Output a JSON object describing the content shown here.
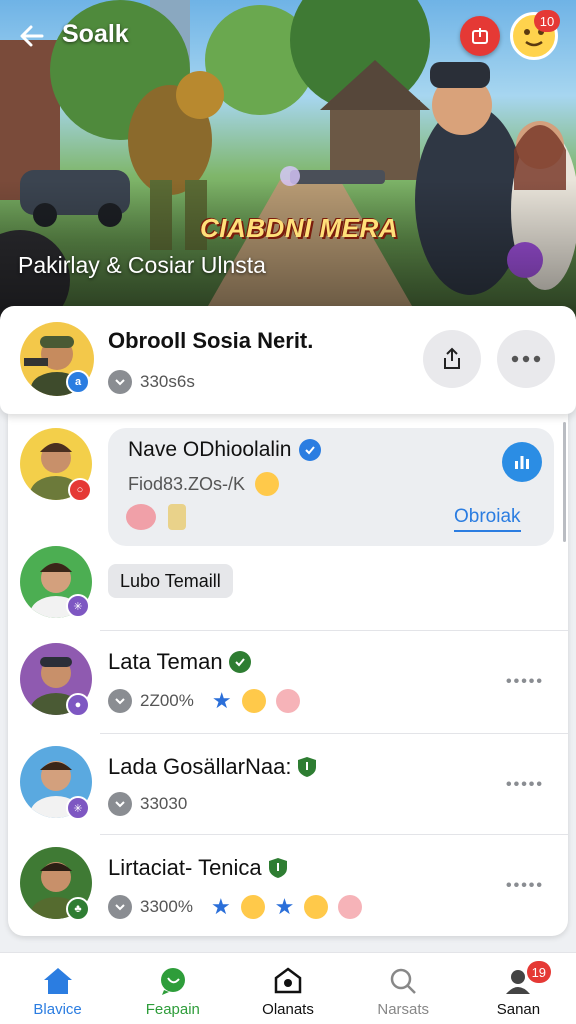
{
  "header": {
    "title": "Soalk",
    "notification_count": "10"
  },
  "banner": {
    "logo_text": "CIABDNI MERA",
    "caption": "Pakirlay & Cosiar Ulnsta"
  },
  "profile": {
    "name": "Obrooll Sosia Nerit.",
    "stat": "330s6s"
  },
  "messages": [
    {
      "name": "Nave ODhioolalin",
      "subtitle": "Fiod83.ZOs-/K",
      "link_label": "Obroiak",
      "chip": "Lubo Temaill"
    }
  ],
  "members": [
    {
      "name": "Lata Teman",
      "stat": "2Z00%",
      "mark": "verified"
    },
    {
      "name": "Lada GosällarNaa:",
      "stat": "33030",
      "mark": "shield"
    },
    {
      "name": "Lirtaciat- Tenica",
      "stat": "3300%",
      "mark": "shield"
    }
  ],
  "member_menu": "•••••",
  "nav": {
    "items": [
      {
        "label": "Blavice",
        "icon": "home-icon",
        "color": "#2b7de1"
      },
      {
        "label": "Feapain",
        "icon": "chat-bubble-icon",
        "color": "#2e9d3a"
      },
      {
        "label": "Olanats",
        "icon": "home-outline-icon",
        "color": "#111111"
      },
      {
        "label": "Narsats",
        "icon": "search-icon",
        "color": "#888888"
      },
      {
        "label": "Sanan",
        "icon": "profile-icon",
        "color": "#111111"
      }
    ],
    "badge": "19"
  },
  "colors": {
    "accent": "#2b7de1",
    "verified": "#2e7d32",
    "alert": "#e53935"
  }
}
